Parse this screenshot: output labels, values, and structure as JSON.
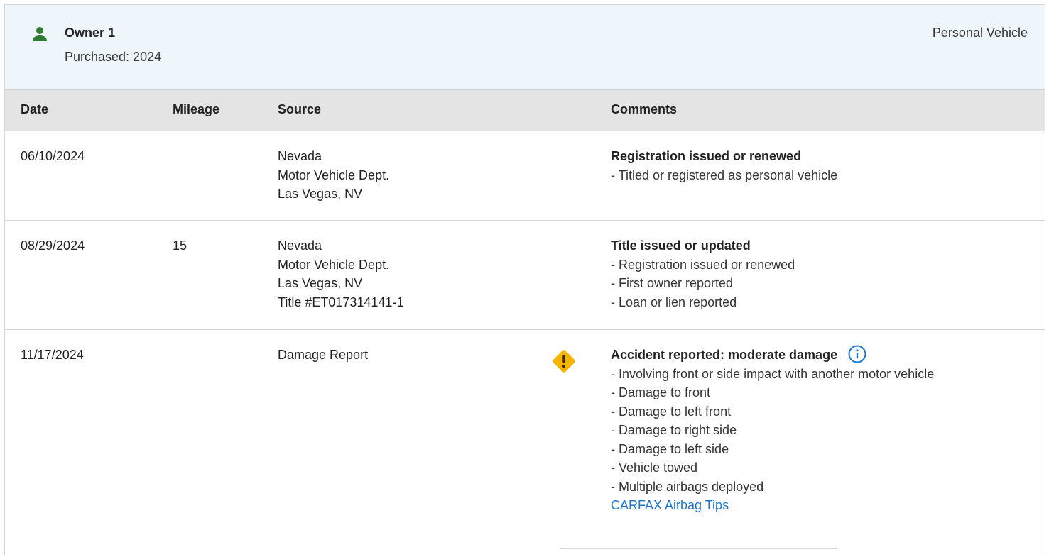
{
  "owner": {
    "title": "Owner 1",
    "purchased": "Purchased: 2024",
    "vehicle_type": "Personal Vehicle",
    "icon": "person-icon",
    "icon_color": "#2e7d32",
    "header_bg": "#eef5fb"
  },
  "table": {
    "headers": {
      "date": "Date",
      "mileage": "Mileage",
      "source": "Source",
      "comments": "Comments"
    },
    "rows": [
      {
        "date": "06/10/2024",
        "mileage": "",
        "source": [
          "Nevada",
          "Motor Vehicle Dept.",
          "Las Vegas, NV"
        ],
        "comment_title": "Registration issued or renewed",
        "comment_lines": [
          "- Titled or registered as personal vehicle"
        ]
      },
      {
        "date": "08/29/2024",
        "mileage": "15",
        "source": [
          "Nevada",
          "Motor Vehicle Dept.",
          "Las Vegas, NV",
          "Title #ET017314141-1"
        ],
        "comment_title": "Title issued or updated",
        "comment_lines": [
          "- Registration issued or renewed",
          "- First owner reported",
          "- Loan or lien reported"
        ]
      },
      {
        "date": "11/17/2024",
        "mileage": "",
        "source": [
          "Damage Report"
        ],
        "icon": "warning-icon",
        "icon_color": "#f4b400",
        "comment_title": "Accident reported: moderate damage",
        "comment_info_icon": "info-icon",
        "comment_lines": [
          "- Involving front or side impact with another motor vehicle",
          "- Damage to front",
          "- Damage to left front",
          "- Damage to right side",
          "- Damage to left side",
          "- Vehicle towed",
          "- Multiple airbags deployed"
        ],
        "link_text": "CARFAX Airbag Tips",
        "link_color": "#1976d2"
      }
    ]
  }
}
